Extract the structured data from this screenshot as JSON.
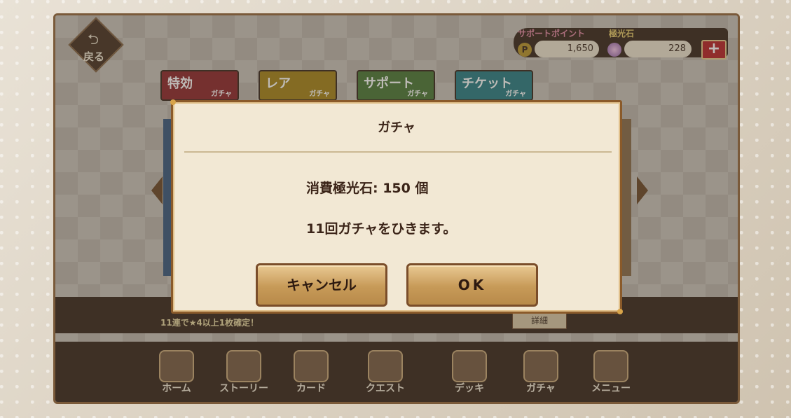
{
  "header": {
    "back_label": "戻る",
    "support_points_title": "サポートポイント",
    "stone_title": "極光石",
    "support_points_icon_text": "P",
    "support_points_value": "1,650",
    "stone_value": "228",
    "plus_label": "+"
  },
  "tabs": [
    {
      "main": "特効",
      "sub": "ガチャ"
    },
    {
      "main": "レア",
      "sub": "ガチャ"
    },
    {
      "main": "サポート",
      "sub": "ガチャ"
    },
    {
      "main": "チケット",
      "sub": "ガチャ"
    }
  ],
  "info": {
    "text": "11連で★4以上1枚確定！",
    "button_label": "詳細"
  },
  "nav": [
    {
      "label": "ホーム",
      "icon": "home-icon"
    },
    {
      "label": "ストーリー",
      "icon": "book-icon"
    },
    {
      "label": "カード",
      "icon": "cards-icon"
    },
    {
      "label": "クエスト",
      "icon": "quest-icon"
    },
    {
      "label": "デッキ",
      "icon": "deck-icon"
    },
    {
      "label": "ガチャ",
      "icon": "gacha-icon"
    },
    {
      "label": "メニュー",
      "icon": "menu-icon"
    }
  ],
  "modal": {
    "title": "ガチャ",
    "line1": "消費極光石: 150 個",
    "line2": "11回ガチャをひきます。",
    "cancel_label": "キャンセル",
    "ok_label": "OK"
  },
  "colors": {
    "modal_bg": "#f2e8d4",
    "button_gold": "#c79a58",
    "dark_brown": "#3b2a1f"
  }
}
